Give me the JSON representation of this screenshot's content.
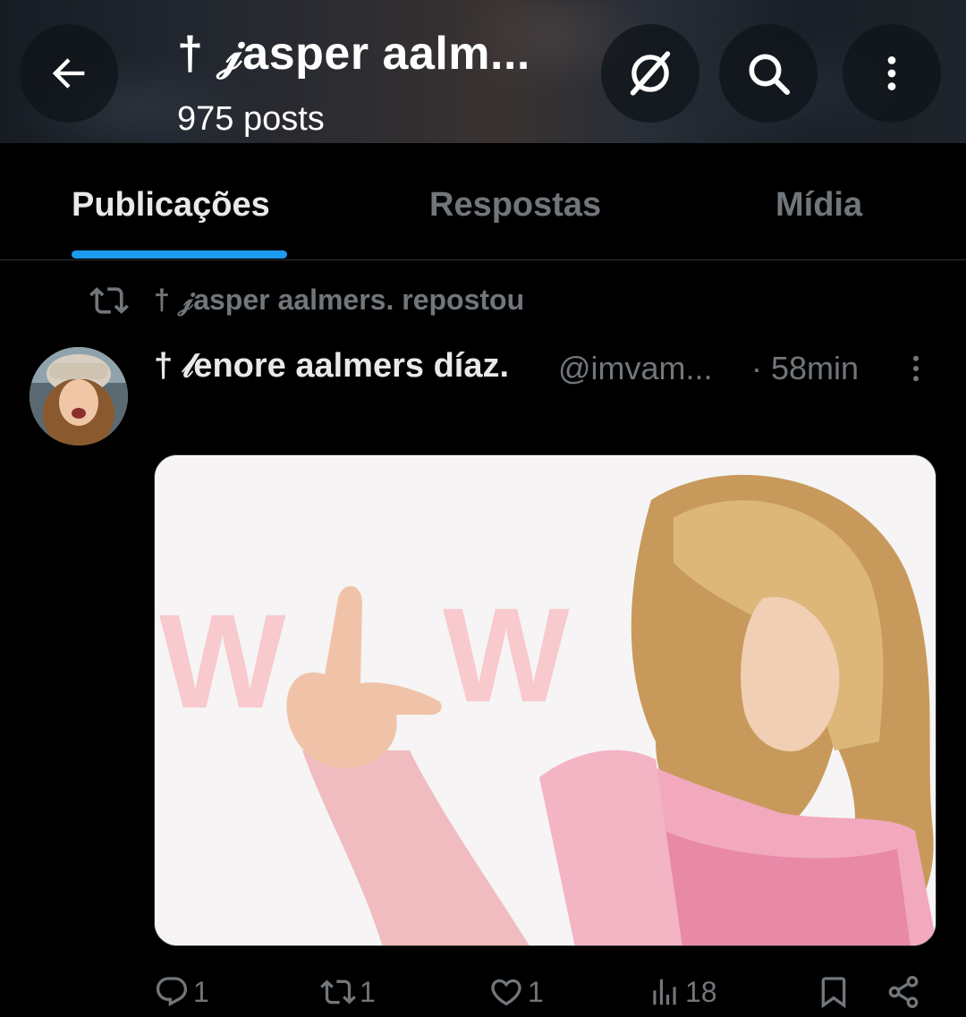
{
  "header": {
    "title": "† 𝒿asper aalm...",
    "subtitle": "975 posts",
    "icons": [
      "back-arrow-icon",
      "grok-icon",
      "search-icon",
      "more-vertical-icon"
    ]
  },
  "tabs": [
    {
      "label": "Publicações",
      "active": true
    },
    {
      "label": "Respostas",
      "active": false
    },
    {
      "label": "Mídia",
      "active": false
    }
  ],
  "accent_color": "#1d9bf0",
  "repost": {
    "text": "† 𝒿asper aalmers. repostou"
  },
  "post": {
    "author_name": "† 𝓁enore aalmers díaz.",
    "handle": "@imvam...",
    "time": "· 58min",
    "media": {
      "letters": [
        "W",
        "W"
      ]
    },
    "actions": {
      "replies": "1",
      "reposts": "1",
      "likes": "1",
      "views": "18"
    }
  }
}
